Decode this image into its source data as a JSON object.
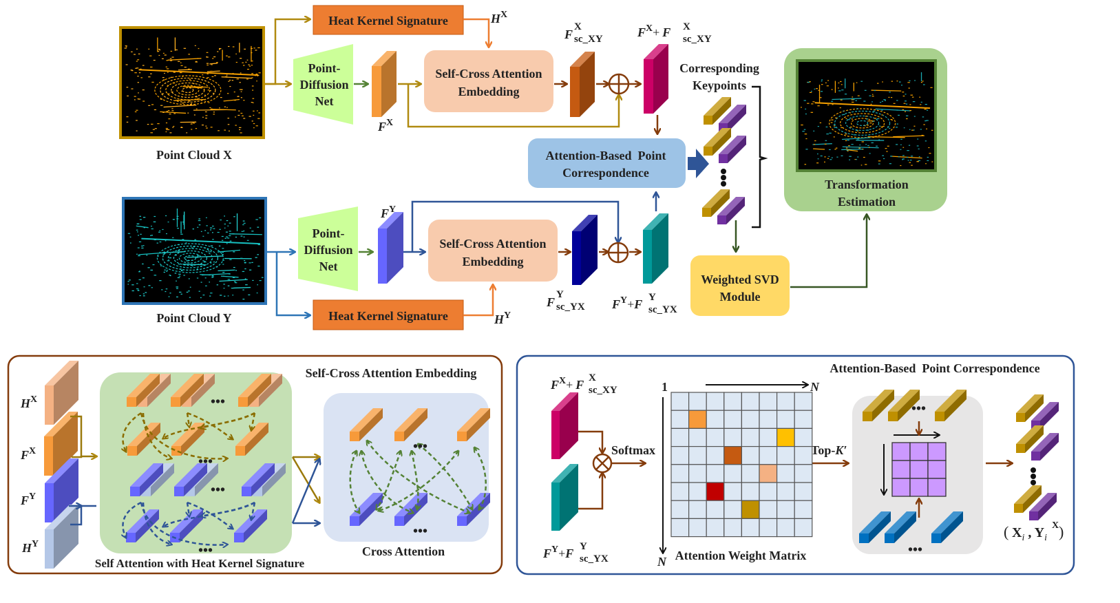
{
  "top": {
    "point_cloud_x": "Point Cloud X",
    "point_cloud_y": "Point Cloud Y",
    "hks_top": "Heat Kernel Signature",
    "hks_bottom": "Heat Kernel Signature",
    "pdn_top": [
      "Point-",
      "Diffusion",
      "Net"
    ],
    "pdn_bottom": [
      "Point-",
      "Diffusion",
      "Net"
    ],
    "sca_top": [
      "Self-Cross Attention",
      "Embedding"
    ],
    "sca_bottom": [
      "Self-Cross Attention",
      "Embedding"
    ],
    "abpc": [
      "Attention-Based  Point",
      "Correspondence"
    ],
    "corr_kp": [
      "Corresponding",
      "Keypoints"
    ],
    "wsvd": [
      "Weighted SVD",
      "Module"
    ],
    "trans": [
      "Transformation",
      "Estimation"
    ],
    "sym": {
      "F": "F",
      "H": "H",
      "X": "X",
      "Y": "Y",
      "sc_xy": "sc_XY",
      "sc_yx": "sc_YX",
      "plus": "+"
    }
  },
  "bottom_left": {
    "title": "Self-Cross Attention Embedding",
    "self_att": "Self Attention with Heat Kernel Signature",
    "cross_att": "Cross Attention",
    "ellipsis": "•••"
  },
  "bottom_right": {
    "title": "Attention-Based  Point Correspondence",
    "softmax": "Softmax",
    "topk": "Top-",
    "kprime": "K′",
    "one": "1",
    "N": "N",
    "matrix_label": "Attention Weight Matrix",
    "Xi": "X",
    "Yj": "Y",
    "pair": "(X",
    "grid": {
      "rows": 8,
      "cols": 8,
      "base_color": "#dde8f4",
      "highlights": [
        {
          "row": 1,
          "col": 1,
          "color": "#f79a3a"
        },
        {
          "row": 2,
          "col": 6,
          "color": "#ffc000"
        },
        {
          "row": 3,
          "col": 3,
          "color": "#c55a11"
        },
        {
          "row": 4,
          "col": 5,
          "color": "#f4b183"
        },
        {
          "row": 5,
          "col": 2,
          "color": "#c00000"
        },
        {
          "row": 6,
          "col": 4,
          "color": "#bf9000"
        }
      ]
    },
    "small_grid": {
      "rows": 3,
      "cols": 3,
      "color": "#cc99ff"
    }
  },
  "colors": {
    "orange": "#ed7d31",
    "olive": "#b08a10",
    "brown": "#843c0c",
    "blue": "#2e75b6",
    "darkblue": "#2f5597",
    "green": "#548235",
    "pdn": "#ccff99",
    "sca": "#f8cbad",
    "abpc": "#9dc3e6",
    "wsvd": "#ffd966",
    "trans": "#a9d18e"
  }
}
